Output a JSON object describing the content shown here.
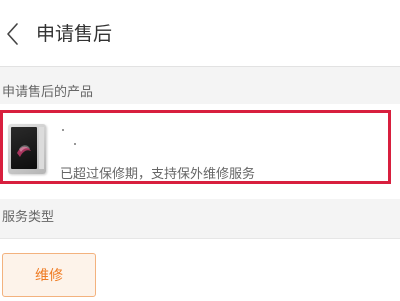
{
  "header": {
    "title": "申请售后",
    "back_icon": "chevron-left-icon"
  },
  "product_section": {
    "label": "申请售后的产品",
    "product": {
      "name": "",
      "warranty_note": "已超过保修期，支持保外维修服务",
      "thumbnail_icon": "phone-icon"
    },
    "highlight_color": "#d81f3e"
  },
  "service_section": {
    "label": "服务类型",
    "options": [
      {
        "label": "维修",
        "selected": true
      }
    ],
    "accent_color": "#ef7a21"
  }
}
